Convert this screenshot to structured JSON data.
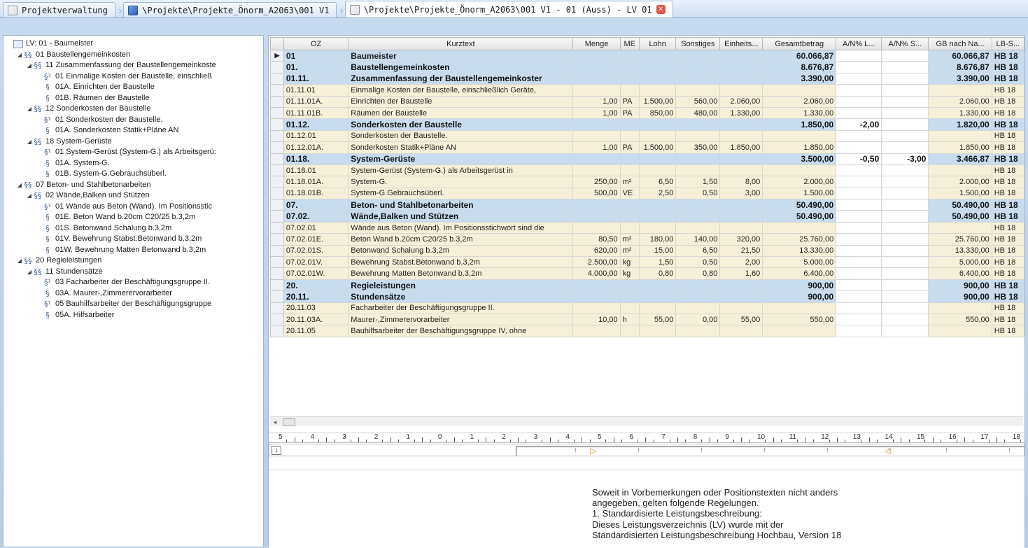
{
  "tabs": [
    {
      "label": "Projektverwaltung",
      "icon": "document-icon",
      "active": false
    },
    {
      "label": "\\Projekte\\Projekte_Önorm_A2063\\001 V1",
      "icon": "project-icon",
      "active": false
    },
    {
      "label": "\\Projekte\\Projekte_Önorm_A2063\\001 V1 - 01 (Auss) - LV 01",
      "icon": "document-icon",
      "active": true
    }
  ],
  "tree": [
    {
      "label": "LV: 01 - Baumeister",
      "level": 0,
      "icon": "lv",
      "expander": ""
    },
    {
      "label": "01 Baustellengemeinkosten",
      "level": 1,
      "icon": "§§",
      "expander": "◢"
    },
    {
      "label": "11 Zusammenfassung der Baustellengemeinkoste",
      "level": 2,
      "icon": "§§",
      "expander": "◢"
    },
    {
      "label": "01 Einmalige Kosten der Baustelle, einschließ",
      "level": 3,
      "icon": "§¹",
      "expander": ""
    },
    {
      "label": "01A.  Einrichten der Baustelle",
      "level": 3,
      "icon": "§",
      "expander": ""
    },
    {
      "label": "01B.  Räumen der Baustelle",
      "level": 3,
      "icon": "§",
      "expander": ""
    },
    {
      "label": "12 Sonderkosten der Baustelle",
      "level": 2,
      "icon": "§§",
      "expander": "◢"
    },
    {
      "label": "01 Sonderkosten der Baustelle.",
      "level": 3,
      "icon": "§¹",
      "expander": ""
    },
    {
      "label": "01A.  Sonderkosten Statik+Pläne AN",
      "level": 3,
      "icon": "§",
      "expander": ""
    },
    {
      "label": "18 System-Gerüste",
      "level": 2,
      "icon": "§§",
      "expander": "◢"
    },
    {
      "label": "01 System-Gerüst (System-G.) als Arbeitsgerü:",
      "level": 3,
      "icon": "§¹",
      "expander": ""
    },
    {
      "label": "01A.  System-G.",
      "level": 3,
      "icon": "§",
      "expander": ""
    },
    {
      "label": "01B.  System-G.Gebrauchsüberl.",
      "level": 3,
      "icon": "§",
      "expander": ""
    },
    {
      "label": "07 Beton- und Stahlbetonarbeiten",
      "level": 1,
      "icon": "§§",
      "expander": "◢"
    },
    {
      "label": "02 Wände,Balken und Stützen",
      "level": 2,
      "icon": "§§",
      "expander": "◢"
    },
    {
      "label": "01 Wände aus Beton (Wand). Im Positionsstic",
      "level": 3,
      "icon": "§¹",
      "expander": ""
    },
    {
      "label": "01E.  Beton Wand b.20cm C20/25 b.3,2m",
      "level": 3,
      "icon": "§",
      "expander": ""
    },
    {
      "label": "01S.  Betonwand Schalung b.3,2m",
      "level": 3,
      "icon": "§",
      "expander": ""
    },
    {
      "label": "01V.  Bewehrung Stabst.Betonwand b.3,2m",
      "level": 3,
      "icon": "§",
      "expander": ""
    },
    {
      "label": "01W.  Bewehrung Matten Betonwand b.3,2m",
      "level": 3,
      "icon": "§",
      "expander": ""
    },
    {
      "label": "20 Regieleistungen",
      "level": 1,
      "icon": "§§",
      "expander": "◢"
    },
    {
      "label": "11 Stundensätze",
      "level": 2,
      "icon": "§§",
      "expander": "◢"
    },
    {
      "label": "03 Facharbeiter der Beschäftigungsgruppe II.",
      "level": 3,
      "icon": "§¹",
      "expander": ""
    },
    {
      "label": "03A.  Maurer-,Zimmerervorarbeiter",
      "level": 3,
      "icon": "§",
      "expander": ""
    },
    {
      "label": "05 Bauhilfsarbeiter der Beschäftigungsgruppe",
      "level": 3,
      "icon": "§¹",
      "expander": ""
    },
    {
      "label": "05A.  Hilfsarbeiter",
      "level": 3,
      "icon": "§",
      "expander": ""
    }
  ],
  "grid": {
    "columns": [
      "",
      "OZ",
      "Kurztext",
      "Menge",
      "ME",
      "Lohn",
      "Sonstiges",
      "Einheits...",
      "Gesamtbetrag",
      "A/N% L...",
      "A/N% S...",
      "GB nach Na...",
      "LB-S..."
    ],
    "rows": [
      {
        "kind": "sel",
        "ind": "▶",
        "oz": "01",
        "text": "Baumeister",
        "menge": "",
        "me": "",
        "lohn": "",
        "sonst": "",
        "einh": "",
        "ges": "60.066,87",
        "anl": "",
        "ans": "",
        "gbn": "60.066,87",
        "lb": "HB 18"
      },
      {
        "kind": "grp",
        "ind": "",
        "oz": "01.",
        "text": "Baustellengemeinkosten",
        "menge": "",
        "me": "",
        "lohn": "",
        "sonst": "",
        "einh": "",
        "ges": "8.676,87",
        "anl": "",
        "ans": "",
        "gbn": "8.676,87",
        "lb": "HB 18"
      },
      {
        "kind": "grp",
        "ind": "",
        "oz": "01.11.",
        "text": "Zusammenfassung der Baustellengemeinkoster",
        "menge": "",
        "me": "",
        "lohn": "",
        "sonst": "",
        "einh": "",
        "ges": "3.390,00",
        "anl": "",
        "ans": "",
        "gbn": "3.390,00",
        "lb": "HB 18"
      },
      {
        "kind": "pos",
        "ind": "",
        "oz": "01.11.01",
        "text": "Einmalige Kosten der Baustelle, einschließlich Geräte,",
        "menge": "",
        "me": "",
        "lohn": "",
        "sonst": "",
        "einh": "",
        "ges": "",
        "anl": "",
        "ans": "",
        "gbn": "",
        "lb": "HB 18"
      },
      {
        "kind": "pos",
        "ind": "",
        "oz": "01.11.01A.",
        "text": "Einrichten der Baustelle",
        "menge": "1,00",
        "me": "PA",
        "lohn": "1.500,00",
        "sonst": "560,00",
        "einh": "2.060,00",
        "ges": "2.060,00",
        "anl": "",
        "ans": "",
        "gbn": "2.060,00",
        "lb": "HB 18"
      },
      {
        "kind": "pos",
        "ind": "",
        "oz": "01.11.01B.",
        "text": "Räumen der Baustelle",
        "menge": "1,00",
        "me": "PA",
        "lohn": "850,00",
        "sonst": "480,00",
        "einh": "1.330,00",
        "ges": "1.330,00",
        "anl": "",
        "ans": "",
        "gbn": "1.330,00",
        "lb": "HB 18"
      },
      {
        "kind": "grp",
        "ind": "",
        "oz": "01.12.",
        "text": "Sonderkosten der Baustelle",
        "menge": "",
        "me": "",
        "lohn": "",
        "sonst": "",
        "einh": "",
        "ges": "1.850,00",
        "anl": "-2,00",
        "ans": "",
        "gbn": "1.820,00",
        "lb": "HB 18"
      },
      {
        "kind": "pos",
        "ind": "",
        "oz": "01.12.01",
        "text": "Sonderkosten der Baustelle.",
        "menge": "",
        "me": "",
        "lohn": "",
        "sonst": "",
        "einh": "",
        "ges": "",
        "anl": "",
        "ans": "",
        "gbn": "",
        "lb": "HB 18"
      },
      {
        "kind": "pos",
        "ind": "",
        "oz": "01.12.01A.",
        "text": "Sonderkosten Statik+Pläne AN",
        "menge": "1,00",
        "me": "PA",
        "lohn": "1.500,00",
        "sonst": "350,00",
        "einh": "1.850,00",
        "ges": "1.850,00",
        "anl": "",
        "ans": "",
        "gbn": "1.850,00",
        "lb": "HB 18"
      },
      {
        "kind": "grp",
        "ind": "",
        "oz": "01.18.",
        "text": "System-Gerüste",
        "menge": "",
        "me": "",
        "lohn": "",
        "sonst": "",
        "einh": "",
        "ges": "3.500,00",
        "anl": "-0,50",
        "ans": "-3,00",
        "gbn": "3.466,87",
        "lb": "HB 18"
      },
      {
        "kind": "pos",
        "ind": "",
        "oz": "01.18.01",
        "text": "System-Gerüst (System-G.) als Arbeitsgerüst in",
        "menge": "",
        "me": "",
        "lohn": "",
        "sonst": "",
        "einh": "",
        "ges": "",
        "anl": "",
        "ans": "",
        "gbn": "",
        "lb": "HB 18"
      },
      {
        "kind": "pos",
        "ind": "",
        "oz": "01.18.01A.",
        "text": "System-G.",
        "menge": "250,00",
        "me": "m²",
        "lohn": "6,50",
        "sonst": "1,50",
        "einh": "8,00",
        "ges": "2.000,00",
        "anl": "",
        "ans": "",
        "gbn": "2.000,00",
        "lb": "HB 18"
      },
      {
        "kind": "pos",
        "ind": "",
        "oz": "01.18.01B.",
        "text": "System-G.Gebrauchsüberl.",
        "menge": "500,00",
        "me": "VE",
        "lohn": "2,50",
        "sonst": "0,50",
        "einh": "3,00",
        "ges": "1.500,00",
        "anl": "",
        "ans": "",
        "gbn": "1.500,00",
        "lb": "HB 18"
      },
      {
        "kind": "grp",
        "ind": "",
        "oz": "07.",
        "text": "Beton- und Stahlbetonarbeiten",
        "menge": "",
        "me": "",
        "lohn": "",
        "sonst": "",
        "einh": "",
        "ges": "50.490,00",
        "anl": "",
        "ans": "",
        "gbn": "50.490,00",
        "lb": "HB 18"
      },
      {
        "kind": "grp",
        "ind": "",
        "oz": "07.02.",
        "text": "Wände,Balken und Stützen",
        "menge": "",
        "me": "",
        "lohn": "",
        "sonst": "",
        "einh": "",
        "ges": "50.490,00",
        "anl": "",
        "ans": "",
        "gbn": "50.490,00",
        "lb": "HB 18"
      },
      {
        "kind": "pos",
        "ind": "",
        "oz": "07.02.01",
        "text": "Wände aus Beton (Wand). Im Positionsstichwort sind die",
        "menge": "",
        "me": "",
        "lohn": "",
        "sonst": "",
        "einh": "",
        "ges": "",
        "anl": "",
        "ans": "",
        "gbn": "",
        "lb": "HB 18"
      },
      {
        "kind": "pos",
        "ind": "",
        "oz": "07.02.01E.",
        "text": "Beton Wand b.20cm C20/25 b.3,2m",
        "menge": "80,50",
        "me": "m²",
        "lohn": "180,00",
        "sonst": "140,00",
        "einh": "320,00",
        "ges": "25.760,00",
        "anl": "",
        "ans": "",
        "gbn": "25.760,00",
        "lb": "HB 18"
      },
      {
        "kind": "pos",
        "ind": "",
        "oz": "07.02.01S.",
        "text": "Betonwand Schalung b.3,2m",
        "menge": "620,00",
        "me": "m²",
        "lohn": "15,00",
        "sonst": "6,50",
        "einh": "21,50",
        "ges": "13.330,00",
        "anl": "",
        "ans": "",
        "gbn": "13.330,00",
        "lb": "HB 18"
      },
      {
        "kind": "pos",
        "ind": "",
        "oz": "07.02.01V.",
        "text": "Bewehrung Stabst.Betonwand b.3,2m",
        "menge": "2.500,00",
        "me": "kg",
        "lohn": "1,50",
        "sonst": "0,50",
        "einh": "2,00",
        "ges": "5.000,00",
        "anl": "",
        "ans": "",
        "gbn": "5.000,00",
        "lb": "HB 18"
      },
      {
        "kind": "pos",
        "ind": "",
        "oz": "07.02.01W.",
        "text": "Bewehrung Matten Betonwand b.3,2m",
        "menge": "4.000,00",
        "me": "kg",
        "lohn": "0,80",
        "sonst": "0,80",
        "einh": "1,60",
        "ges": "6.400,00",
        "anl": "",
        "ans": "",
        "gbn": "6.400,00",
        "lb": "HB 18"
      },
      {
        "kind": "grp",
        "ind": "",
        "oz": "20.",
        "text": "Regieleistungen",
        "menge": "",
        "me": "",
        "lohn": "",
        "sonst": "",
        "einh": "",
        "ges": "900,00",
        "anl": "",
        "ans": "",
        "gbn": "900,00",
        "lb": "HB 18"
      },
      {
        "kind": "grp",
        "ind": "",
        "oz": "20.11.",
        "text": "Stundensätze",
        "menge": "",
        "me": "",
        "lohn": "",
        "sonst": "",
        "einh": "",
        "ges": "900,00",
        "anl": "",
        "ans": "",
        "gbn": "900,00",
        "lb": "HB 18"
      },
      {
        "kind": "pos",
        "ind": "",
        "oz": "20.11.03",
        "text": "Facharbeiter der Beschäftigungsgruppe II.",
        "menge": "",
        "me": "",
        "lohn": "",
        "sonst": "",
        "einh": "",
        "ges": "",
        "anl": "",
        "ans": "",
        "gbn": "",
        "lb": "HB 18"
      },
      {
        "kind": "pos",
        "ind": "",
        "oz": "20.11.03A.",
        "text": "Maurer-,Zimmerervorarbeiter",
        "menge": "10,00",
        "me": "h",
        "lohn": "55,00",
        "sonst": "0,00",
        "einh": "55,00",
        "ges": "550,00",
        "anl": "",
        "ans": "",
        "gbn": "550,00",
        "lb": "HB 18"
      },
      {
        "kind": "pos",
        "ind": "",
        "oz": "20.11.05",
        "text": "Bauhilfsarbeiter der Beschäftigungsgruppe IV, ohne",
        "menge": "",
        "me": "",
        "lohn": "",
        "sonst": "",
        "einh": "",
        "ges": "",
        "anl": "",
        "ans": "",
        "gbn": "",
        "lb": "HB 18"
      }
    ]
  },
  "ruler": {
    "labels": [
      "5",
      "4",
      "3",
      "2",
      "1",
      "0",
      "1",
      "2",
      "3",
      "4",
      "5",
      "6",
      "7",
      "8",
      "9",
      "10",
      "11",
      "12",
      "13",
      "14",
      "15",
      "16",
      "17",
      "18"
    ]
  },
  "editor": {
    "lines": [
      "Soweit in Vorbemerkungen oder Positionstexten nicht anders",
      "angegeben, gelten folgende Regelungen.",
      "1. Standardisierte Leistungsbeschreibung:",
      "Dieses Leistungsverzeichnis (LV) wurde mit der",
      "Standardisierten Leistungsbeschreibung Hochbau, Version 18"
    ]
  }
}
